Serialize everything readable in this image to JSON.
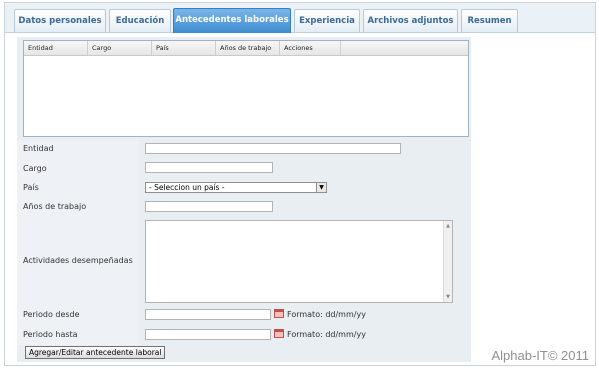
{
  "tabs": [
    {
      "label": "Datos personales",
      "active": false
    },
    {
      "label": "Educación",
      "active": false
    },
    {
      "label": "Antecedentes laborales",
      "active": true
    },
    {
      "label": "Experiencia",
      "active": false
    },
    {
      "label": "Archivos adjuntos",
      "active": false
    },
    {
      "label": "Resumen",
      "active": false
    }
  ],
  "grid": {
    "columns": [
      "Entidad",
      "Cargo",
      "País",
      "Años de trabajo",
      "Acciones"
    ],
    "rows": []
  },
  "form": {
    "entidad_label": "Entidad",
    "entidad_value": "",
    "cargo_label": "Cargo",
    "cargo_value": "",
    "pais_label": "País",
    "pais_selected": "- Seleccion un país -",
    "anios_label": "Años de trabajo",
    "anios_value": "",
    "actividades_label": "Actividades desempeñadas",
    "actividades_value": "",
    "periodo_desde_label": "Periodo desde",
    "periodo_desde_value": "",
    "periodo_desde_format": "Formato: dd/mm/yy",
    "periodo_hasta_label": "Periodo hasta",
    "periodo_hasta_value": "",
    "periodo_hasta_format": "Formato: dd/mm/yy",
    "submit_label": "Agregar/Editar antecedente laboral"
  },
  "watermark": "Alphab-IT© 2011",
  "colors": {
    "tab_active_bg": "#4a94d6",
    "tab_text": "#3a6b98",
    "panel_bg": "#e9eef3",
    "calendar_icon": "#c0504d"
  }
}
